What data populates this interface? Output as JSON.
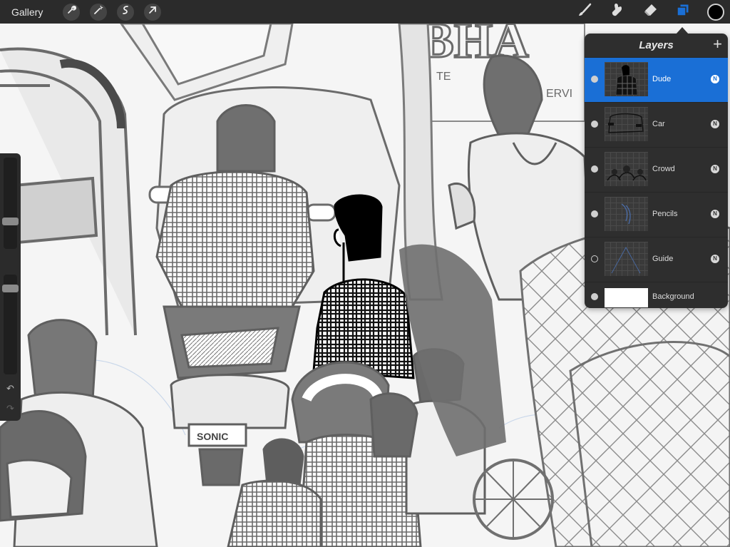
{
  "toolbar": {
    "gallery_label": "Gallery",
    "left_tools": [
      {
        "icon": "wrench-icon"
      },
      {
        "icon": "magic-wand-icon"
      },
      {
        "icon": "selection-icon"
      },
      {
        "icon": "transform-arrow-icon"
      }
    ],
    "right_tools": [
      {
        "icon": "brush-icon"
      },
      {
        "icon": "smudge-icon"
      },
      {
        "icon": "eraser-icon"
      },
      {
        "icon": "layers-icon",
        "active_color": "#1a6fd6"
      }
    ],
    "current_color": "#000000"
  },
  "sidebar": {
    "undo_icon": "↶",
    "redo_icon": "↷"
  },
  "canvas": {
    "sign_texts": [
      "BHA",
      "TE",
      "ERVI"
    ],
    "plate_text": "SONIC"
  },
  "layers": {
    "title": "Layers",
    "add_symbol": "+",
    "items": [
      {
        "name": "Dude",
        "visible": true,
        "selected": true,
        "blend": "N"
      },
      {
        "name": "Car",
        "visible": true,
        "selected": false,
        "blend": "N"
      },
      {
        "name": "Crowd",
        "visible": true,
        "selected": false,
        "blend": "N"
      },
      {
        "name": "Pencils",
        "visible": true,
        "selected": false,
        "blend": "N"
      },
      {
        "name": "Guide",
        "visible": false,
        "selected": false,
        "blend": "N"
      }
    ],
    "background": {
      "name": "Background",
      "visible": true
    }
  }
}
